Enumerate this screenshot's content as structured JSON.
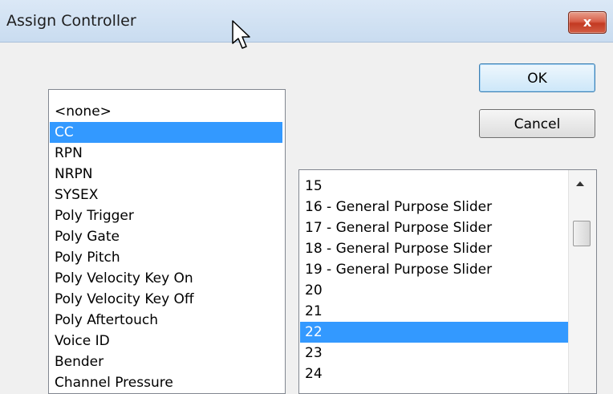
{
  "window": {
    "title": "Assign Controller",
    "close_glyph": "x"
  },
  "buttons": {
    "ok": "OK",
    "cancel": "Cancel"
  },
  "type_list": {
    "selected_index": 1,
    "items": [
      "<none>",
      "CC",
      "RPN",
      "NRPN",
      "SYSEX",
      "Poly Trigger",
      "Poly Gate",
      "Poly Pitch",
      "Poly Velocity Key On",
      "Poly Velocity Key Off",
      "Poly Aftertouch",
      "Voice ID",
      "Bender",
      "Channel Pressure"
    ]
  },
  "number_list": {
    "selected_index": 7,
    "items": [
      "15",
      "16 - General Purpose Slider",
      "17 - General Purpose Slider",
      "18 - General Purpose Slider",
      "19 - General Purpose Slider",
      "20",
      "21",
      "22",
      "23",
      "24"
    ]
  },
  "colors": {
    "selection": "#3399ff",
    "close": "#c33a22"
  },
  "icons": {
    "cursor": "mouse-pointer-icon",
    "close": "close-icon",
    "scroll_up": "arrow-up-icon"
  }
}
